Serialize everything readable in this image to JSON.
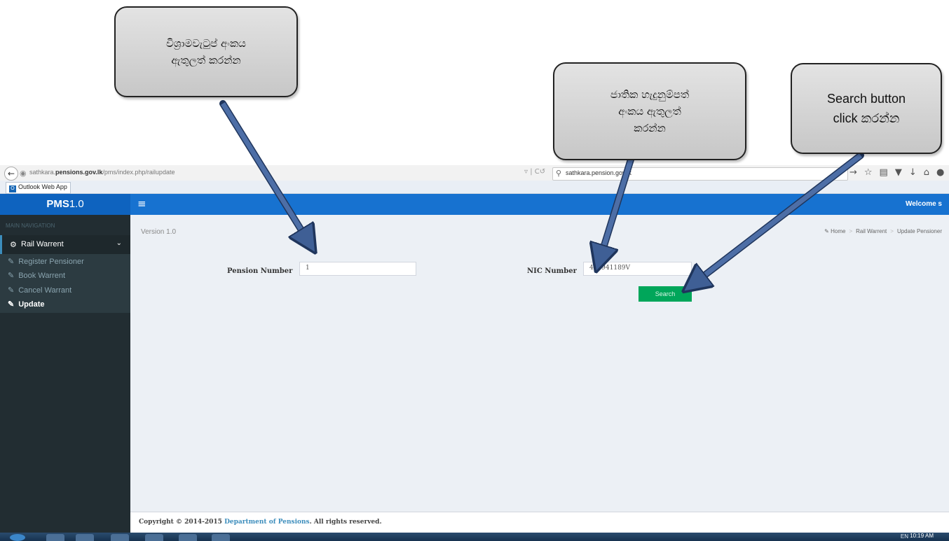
{
  "browser": {
    "url_host_prefix": "sathkara.",
    "url_host_bold": "pensions.gov.lk",
    "url_path": "/pms/index.php/railupdate",
    "search_value": "sathkara.pension.gov.lk",
    "bookmark": "Outlook Web App",
    "bookmark_icon_text": "O"
  },
  "header": {
    "brand_bold": "PMS",
    "brand_rest": "1.0",
    "welcome": "Welcome s"
  },
  "sidebar": {
    "nav_header": "MAIN NAVIGATION",
    "section": "Rail Warrent",
    "items": [
      {
        "label": "Register Pensioner"
      },
      {
        "label": "Book Warrent"
      },
      {
        "label": "Cancel Warrant"
      },
      {
        "label": "Update"
      }
    ]
  },
  "content": {
    "version": "Version 1.0",
    "breadcrumb": [
      "Home",
      "Rail Warrent",
      "Update Pensioner"
    ],
    "pension_label": "Pension Number",
    "pension_value": "1",
    "nic_label": "NIC Number",
    "nic_value": "485941189V",
    "search_button": "Search"
  },
  "footer": {
    "prefix": "Copyright © 2014-2015 ",
    "link": "Department of Pensions",
    "suffix": ". All rights reserved."
  },
  "taskbar": {
    "tray": "EN",
    "clock": "10:19 AM"
  },
  "callouts": {
    "pension": [
      "විශ්‍රාමවැටුප් අංකය",
      "ඇතුලත් කරන්න"
    ],
    "nic": [
      "ජාතික හැදුනුම්පත්",
      "අංකය ඇතුලත්",
      "කරන්න"
    ],
    "search": [
      "Search button",
      "click කරන්න"
    ]
  },
  "colors": {
    "header_blue": "#1772d0",
    "sidebar_dark": "#222d32",
    "button_green": "#00a65a",
    "arrow_blue": "#3f5f95"
  }
}
